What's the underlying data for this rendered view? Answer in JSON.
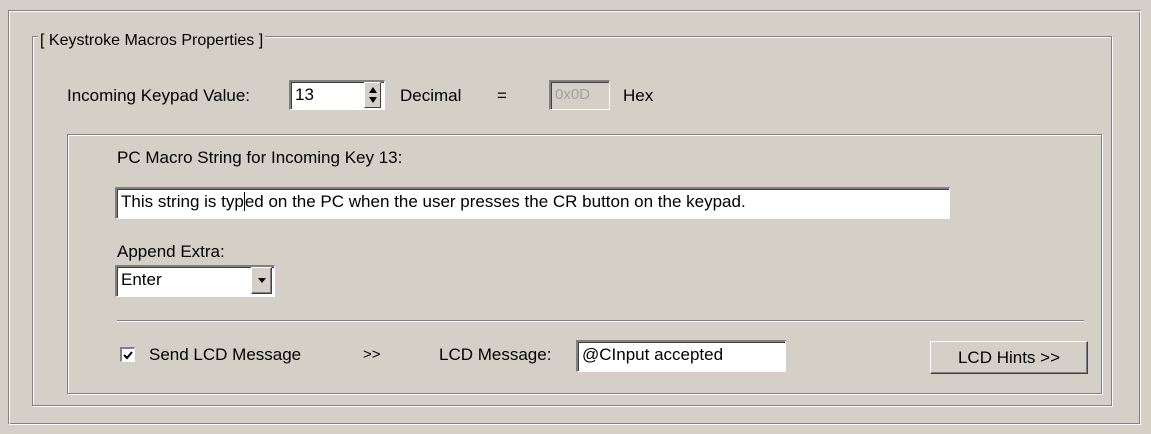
{
  "group": {
    "title": "[ Keystroke Macros Properties ]"
  },
  "keypad": {
    "label": "Incoming Keypad Value:",
    "value": "13",
    "decimal_label": "Decimal",
    "equals": "=",
    "hex_value": "0x0D",
    "hex_label": "Hex"
  },
  "macro": {
    "label": "PC Macro String for Incoming Key 13:",
    "value_before_caret": "This string is typ",
    "value_after_caret": "ed on the PC when the user presses the CR button on the keypad."
  },
  "append": {
    "label": "Append Extra:",
    "selected": "Enter"
  },
  "lcd": {
    "send_label": "Send LCD Message",
    "send_checked": true,
    "arrow": ">>",
    "message_label": "LCD Message:",
    "message_value": "@CInput accepted",
    "hints_button": "LCD Hints >>"
  },
  "icons": {
    "spin": "up-down-spin-icon",
    "dropdown": "chevron-down-icon",
    "check": "checkmark-icon"
  }
}
